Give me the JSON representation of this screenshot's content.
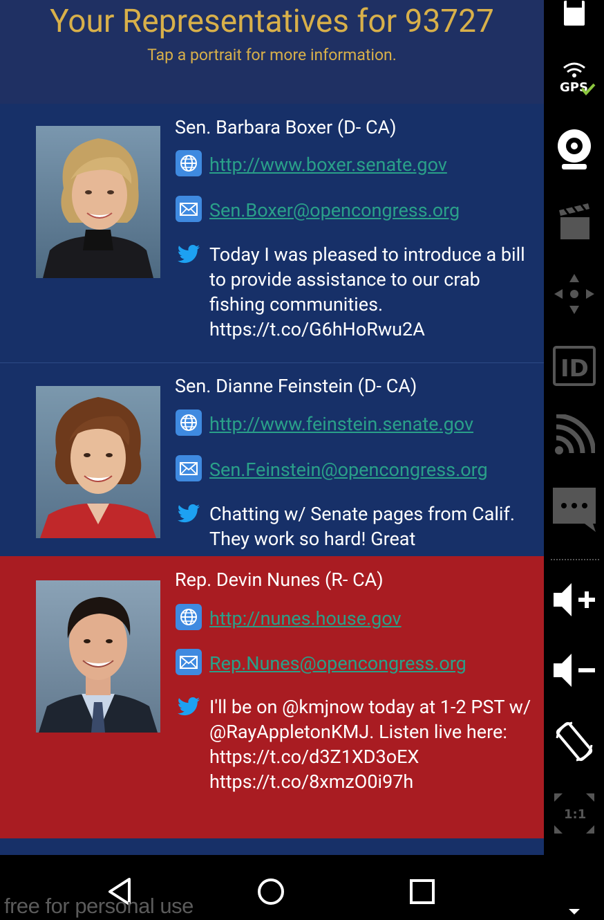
{
  "header": {
    "title": "Your Representatives for 93727",
    "subtitle": "Tap a portrait for more information."
  },
  "representatives": [
    {
      "name": "Sen. Barbara Boxer (D- CA)",
      "party": "D",
      "url": "http://www.boxer.senate.gov",
      "email": "Sen.Boxer@opencongress.org",
      "tweet": "Today I was pleased to introduce a bill to provide assistance to our crab fishing communities. https://t.co/G6hHoRwu2A"
    },
    {
      "name": "Sen. Dianne Feinstein (D- CA)",
      "party": "D",
      "url": "http://www.feinstein.senate.gov",
      "email": "Sen.Feinstein@opencongress.org",
      "tweet": "Chatting w/ Senate pages from Calif. They work so hard! Great"
    },
    {
      "name": "Rep. Devin Nunes (R- CA)",
      "party": "R",
      "url": "http://nunes.house.gov",
      "email": "Rep.Nunes@opencongress.org",
      "tweet": "I'll be on @kmjnow today at 1-2 PST w/ @RayAppletonKMJ. Listen live here:  https://t.co/d3Z1XD3oEX https://t.co/8xmzO0i97h"
    }
  ],
  "sidebar": {
    "items": [
      "battery-icon",
      "gps-icon",
      "webcam-icon",
      "clapperboard-icon",
      "dpad-icon",
      "id-icon",
      "cast-icon",
      "sms-icon",
      "volume-up-icon",
      "volume-down-icon",
      "rotate-icon",
      "scale-icon"
    ],
    "gps_label": "GPS",
    "id_label": "ID",
    "scale_label": "1:1"
  },
  "navbar": {
    "items": [
      "back-icon",
      "home-icon",
      "recents-icon"
    ]
  },
  "watermark": "free for personal use",
  "colors": {
    "header_bg": "#1f3063",
    "header_text": "#d8b04a",
    "democrat_bg": "#173068",
    "republican_bg": "#a91c22",
    "link": "#2aa089",
    "icon_blue": "#3f8ae0",
    "twitter": "#1da1f2"
  }
}
